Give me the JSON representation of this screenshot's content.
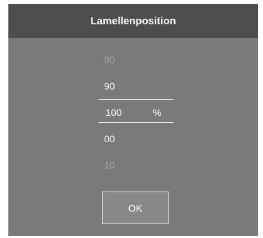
{
  "dialog": {
    "title": "Lamellenposition",
    "picker": {
      "items": [
        "80",
        "90",
        "100",
        "00",
        "10"
      ],
      "selected_value": "100",
      "unit": "%"
    },
    "ok_button_label": "OK"
  },
  "colors": {
    "header_background": "#4d4d4d",
    "dialog_background": "#7a7a7a",
    "text": "#ffffff"
  }
}
